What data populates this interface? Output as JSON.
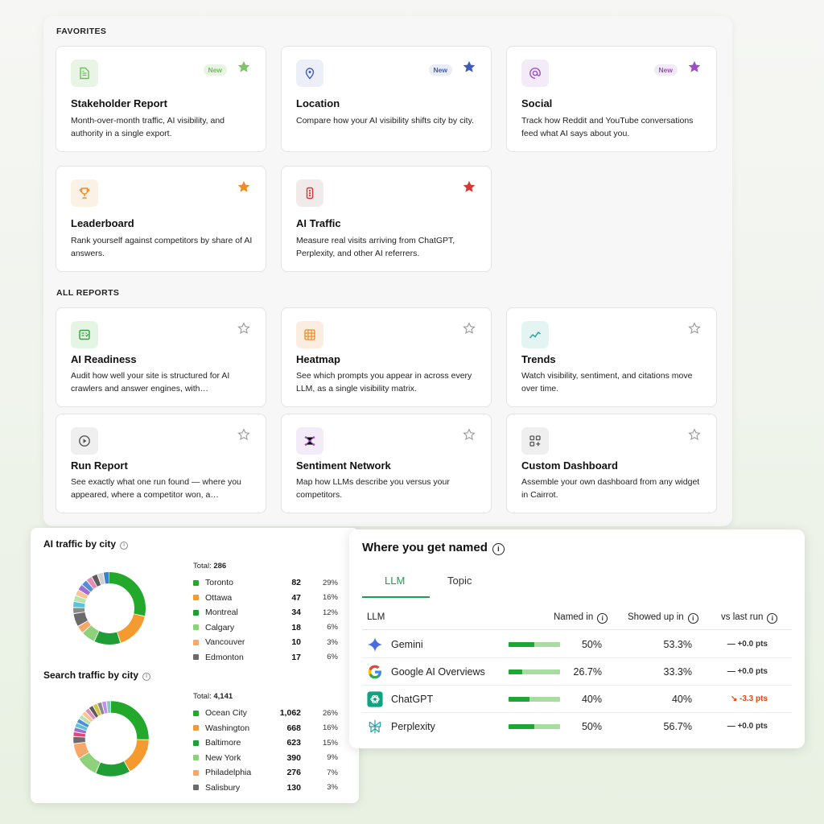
{
  "favorites": {
    "label": "FAVORITES",
    "cards": [
      {
        "title": "Stakeholder Report",
        "desc": "Month-over-month traffic, AI visibility, and authority in a single export.",
        "badge": "New",
        "icon": "document-icon",
        "star_color": "#7cc36a"
      },
      {
        "title": "Location",
        "desc": "Compare how your AI visibility shifts city by city.",
        "badge": "New",
        "icon": "location-pin-icon",
        "star_color": "#3f5bbd"
      },
      {
        "title": "Social",
        "desc": "Track how Reddit and YouTube conversations feed what AI says about you.",
        "badge": "New",
        "icon": "at-sign-icon",
        "star_color": "#9b4fc2"
      },
      {
        "title": "Leaderboard",
        "desc": "Rank yourself against competitors by share of AI answers.",
        "icon": "trophy-icon",
        "star_color": "#f08c28"
      },
      {
        "title": "AI Traffic",
        "desc": "Measure real visits arriving from ChatGPT, Perplexity, and other AI referrers.",
        "icon": "traffic-light-icon",
        "star_color": "#d93535"
      }
    ]
  },
  "all_reports": {
    "label": "ALL REPORTS",
    "cards": [
      {
        "title": "AI Readiness",
        "desc": "Audit how well your site is structured for AI crawlers and answer engines, with…",
        "icon": "checklist-icon"
      },
      {
        "title": "Heatmap",
        "desc": "See which prompts you appear in across every LLM, as a single visibility matrix.",
        "icon": "grid-icon"
      },
      {
        "title": "Trends",
        "desc": "Watch visibility, sentiment, and citations move over time.",
        "icon": "trend-line-icon"
      },
      {
        "title": "Run Report",
        "desc": "See exactly what one run found — where you appeared, where a competitor won, a…",
        "icon": "play-circle-icon"
      },
      {
        "title": "Sentiment Network",
        "desc": "Map how LLMs describe you versus your competitors.",
        "icon": "network-icon"
      },
      {
        "title": "Custom Dashboard",
        "desc": "Assemble your own dashboard from any widget in Cairrot.",
        "icon": "dashboard-add-icon"
      }
    ]
  },
  "ai_traffic": {
    "title": "AI traffic by city",
    "total_label": "Total:",
    "total": "286",
    "rows": [
      {
        "name": "Toronto",
        "count": "82",
        "pct": "29%",
        "color": "#22a82a"
      },
      {
        "name": "Ottawa",
        "count": "47",
        "pct": "16%",
        "color": "#f59a2f"
      },
      {
        "name": "Montreal",
        "count": "34",
        "pct": "12%",
        "color": "#1e9e35"
      },
      {
        "name": "Calgary",
        "count": "18",
        "pct": "6%",
        "color": "#8ed17a"
      },
      {
        "name": "Vancouver",
        "count": "10",
        "pct": "3%",
        "color": "#f5a86a"
      },
      {
        "name": "Edmonton",
        "count": "17",
        "pct": "6%",
        "color": "#6b6b6b"
      }
    ]
  },
  "search_traffic": {
    "title": "Search traffic by city",
    "total_label": "Total:",
    "total": "4,141",
    "rows": [
      {
        "name": "Ocean City",
        "count": "1,062",
        "pct": "26%",
        "color": "#22a82a"
      },
      {
        "name": "Washington",
        "count": "668",
        "pct": "16%",
        "color": "#f59a2f"
      },
      {
        "name": "Baltimore",
        "count": "623",
        "pct": "15%",
        "color": "#1e9e35"
      },
      {
        "name": "New York",
        "count": "390",
        "pct": "9%",
        "color": "#8ed17a"
      },
      {
        "name": "Philadelphia",
        "count": "276",
        "pct": "7%",
        "color": "#f5a86a"
      },
      {
        "name": "Salisbury",
        "count": "130",
        "pct": "3%",
        "color": "#6b6b6b"
      }
    ]
  },
  "chart_data": [
    {
      "type": "pie",
      "title": "AI traffic by city",
      "categories": [
        "Toronto",
        "Ottawa",
        "Montreal",
        "Calgary",
        "Vancouver",
        "Edmonton"
      ],
      "values": [
        82,
        47,
        34,
        18,
        10,
        17
      ],
      "total": 286,
      "colors": [
        "#22a82a",
        "#f59a2f",
        "#1e9e35",
        "#8ed17a",
        "#f5a86a",
        "#6b6b6b"
      ],
      "other_colors": [
        "#8a8a8a",
        "#58c4dc",
        "#b9e3ad",
        "#f7c596",
        "#9c6fd1",
        "#4f8fd8",
        "#e58bb8",
        "#5b5b5b",
        "#d0d0d0",
        "#3f7fd0"
      ],
      "legend": "right"
    },
    {
      "type": "pie",
      "title": "Search traffic by city",
      "categories": [
        "Ocean City",
        "Washington",
        "Baltimore",
        "New York",
        "Philadelphia",
        "Salisbury"
      ],
      "values": [
        1062,
        668,
        623,
        390,
        276,
        130
      ],
      "total": 4141,
      "colors": [
        "#22a82a",
        "#f59a2f",
        "#1e9e35",
        "#8ed17a",
        "#f5a86a",
        "#6b6b6b"
      ],
      "other_colors": [
        "#e0457b",
        "#9c6fd1",
        "#58c4dc",
        "#4f8fd8",
        "#b9e3ad",
        "#f7c596",
        "#e58bb8",
        "#5b5b5b",
        "#d6c23a",
        "#8a8a8a",
        "#c48ee8",
        "#7fd0c0"
      ],
      "legend": "right"
    }
  ],
  "named": {
    "title": "Where you get named",
    "tabs": [
      {
        "label": "LLM"
      },
      {
        "label": "Topic"
      }
    ],
    "headers": {
      "llm": "LLM",
      "named_in": "Named in",
      "showed_up": "Showed up in",
      "vs_last": "vs last run"
    },
    "rows": [
      {
        "name": "Gemini",
        "named": "50%",
        "named_frac": 0.5,
        "showed": "53.3%",
        "delta": "— +0.0 pts",
        "icon": "gemini-icon",
        "dir": "flat"
      },
      {
        "name": "Google AI Overviews",
        "named": "26.7%",
        "named_frac": 0.267,
        "showed": "33.3%",
        "delta": "— +0.0 pts",
        "icon": "google-icon",
        "dir": "flat"
      },
      {
        "name": "ChatGPT",
        "named": "40%",
        "named_frac": 0.4,
        "showed": "40%",
        "delta": "↘ -3.3 pts",
        "icon": "chatgpt-icon",
        "dir": "down"
      },
      {
        "name": "Perplexity",
        "named": "50%",
        "named_frac": 0.5,
        "showed": "56.7%",
        "delta": "— +0.0 pts",
        "icon": "perplexity-icon",
        "dir": "flat"
      }
    ]
  }
}
